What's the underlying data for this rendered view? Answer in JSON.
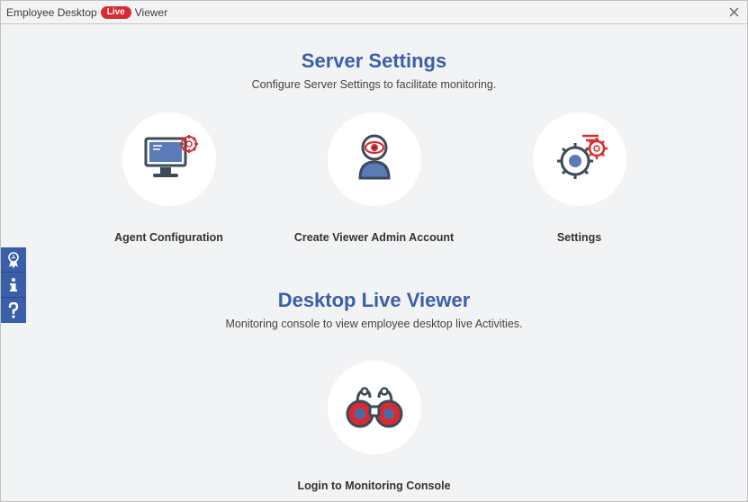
{
  "titlebar": {
    "prefix": "Employee Desktop",
    "badge": "Live",
    "suffix": "Viewer"
  },
  "section1": {
    "title": "Server Settings",
    "subtitle": "Configure Server Settings to facilitate monitoring.",
    "cards": [
      {
        "label": "Agent Configuration"
      },
      {
        "label": "Create Viewer Admin Account"
      },
      {
        "label": "Settings"
      }
    ]
  },
  "section2": {
    "title": "Desktop Live Viewer",
    "subtitle": "Monitoring console to view employee desktop live Activities.",
    "card": {
      "label": "Login to Monitoring Console"
    }
  }
}
